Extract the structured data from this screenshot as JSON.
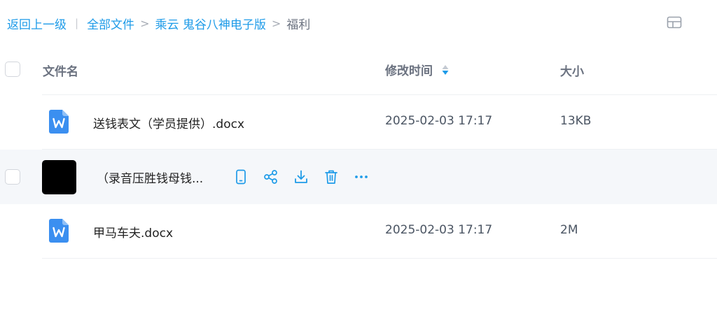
{
  "breadcrumb": {
    "back": "返回上一级",
    "separator": "|",
    "all_files": "全部文件",
    "folder": "乘云 鬼谷八神电子版",
    "current": "福利",
    "arrow": ">"
  },
  "table": {
    "headers": {
      "name": "文件名",
      "modified": "修改时间",
      "size": "大小"
    },
    "rows": [
      {
        "name": "送钱表文（学员提供）.docx",
        "modified": "2025-02-03 17:17",
        "size": "13KB",
        "icon": "word-doc-icon"
      },
      {
        "name": "（录音压胜钱母钱...",
        "modified": "",
        "size": "",
        "icon": "image-thumbnail",
        "hovered": true
      },
      {
        "name": "甲马车夫.docx",
        "modified": "2025-02-03 17:17",
        "size": "2M",
        "icon": "word-doc-icon"
      }
    ]
  },
  "row_actions": [
    "phone-icon",
    "share-icon",
    "download-icon",
    "delete-icon",
    "more-icon"
  ],
  "colors": {
    "accent": "#1e9be8",
    "word_icon": "#3b8ff0",
    "hover_row": "#f5f7fa"
  }
}
